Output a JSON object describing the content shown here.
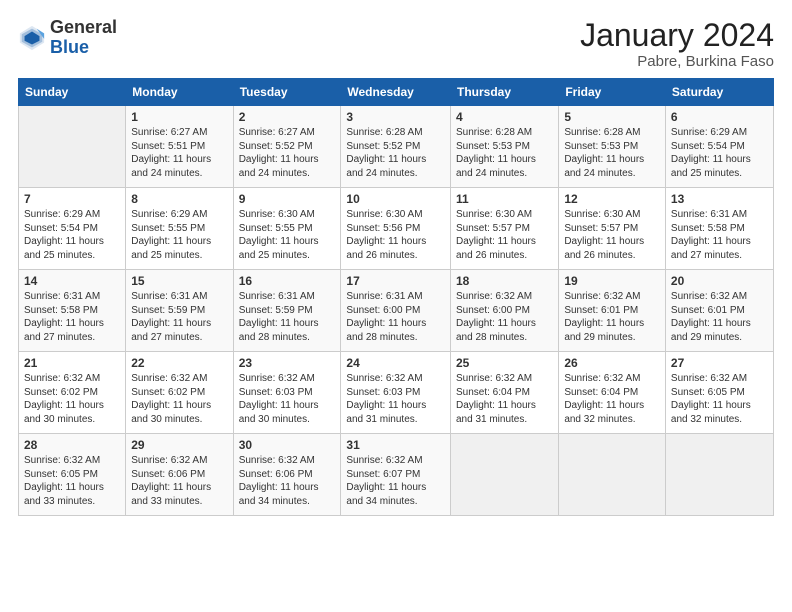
{
  "header": {
    "logo_general": "General",
    "logo_blue": "Blue",
    "title": "January 2024",
    "subtitle": "Pabre, Burkina Faso"
  },
  "days_of_week": [
    "Sunday",
    "Monday",
    "Tuesday",
    "Wednesday",
    "Thursday",
    "Friday",
    "Saturday"
  ],
  "weeks": [
    [
      {
        "day": "",
        "sunrise": "",
        "sunset": "",
        "daylight": ""
      },
      {
        "day": "1",
        "sunrise": "Sunrise: 6:27 AM",
        "sunset": "Sunset: 5:51 PM",
        "daylight": "Daylight: 11 hours and 24 minutes."
      },
      {
        "day": "2",
        "sunrise": "Sunrise: 6:27 AM",
        "sunset": "Sunset: 5:52 PM",
        "daylight": "Daylight: 11 hours and 24 minutes."
      },
      {
        "day": "3",
        "sunrise": "Sunrise: 6:28 AM",
        "sunset": "Sunset: 5:52 PM",
        "daylight": "Daylight: 11 hours and 24 minutes."
      },
      {
        "day": "4",
        "sunrise": "Sunrise: 6:28 AM",
        "sunset": "Sunset: 5:53 PM",
        "daylight": "Daylight: 11 hours and 24 minutes."
      },
      {
        "day": "5",
        "sunrise": "Sunrise: 6:28 AM",
        "sunset": "Sunset: 5:53 PM",
        "daylight": "Daylight: 11 hours and 24 minutes."
      },
      {
        "day": "6",
        "sunrise": "Sunrise: 6:29 AM",
        "sunset": "Sunset: 5:54 PM",
        "daylight": "Daylight: 11 hours and 25 minutes."
      }
    ],
    [
      {
        "day": "7",
        "sunrise": "Sunrise: 6:29 AM",
        "sunset": "Sunset: 5:54 PM",
        "daylight": "Daylight: 11 hours and 25 minutes."
      },
      {
        "day": "8",
        "sunrise": "Sunrise: 6:29 AM",
        "sunset": "Sunset: 5:55 PM",
        "daylight": "Daylight: 11 hours and 25 minutes."
      },
      {
        "day": "9",
        "sunrise": "Sunrise: 6:30 AM",
        "sunset": "Sunset: 5:55 PM",
        "daylight": "Daylight: 11 hours and 25 minutes."
      },
      {
        "day": "10",
        "sunrise": "Sunrise: 6:30 AM",
        "sunset": "Sunset: 5:56 PM",
        "daylight": "Daylight: 11 hours and 26 minutes."
      },
      {
        "day": "11",
        "sunrise": "Sunrise: 6:30 AM",
        "sunset": "Sunset: 5:57 PM",
        "daylight": "Daylight: 11 hours and 26 minutes."
      },
      {
        "day": "12",
        "sunrise": "Sunrise: 6:30 AM",
        "sunset": "Sunset: 5:57 PM",
        "daylight": "Daylight: 11 hours and 26 minutes."
      },
      {
        "day": "13",
        "sunrise": "Sunrise: 6:31 AM",
        "sunset": "Sunset: 5:58 PM",
        "daylight": "Daylight: 11 hours and 27 minutes."
      }
    ],
    [
      {
        "day": "14",
        "sunrise": "Sunrise: 6:31 AM",
        "sunset": "Sunset: 5:58 PM",
        "daylight": "Daylight: 11 hours and 27 minutes."
      },
      {
        "day": "15",
        "sunrise": "Sunrise: 6:31 AM",
        "sunset": "Sunset: 5:59 PM",
        "daylight": "Daylight: 11 hours and 27 minutes."
      },
      {
        "day": "16",
        "sunrise": "Sunrise: 6:31 AM",
        "sunset": "Sunset: 5:59 PM",
        "daylight": "Daylight: 11 hours and 28 minutes."
      },
      {
        "day": "17",
        "sunrise": "Sunrise: 6:31 AM",
        "sunset": "Sunset: 6:00 PM",
        "daylight": "Daylight: 11 hours and 28 minutes."
      },
      {
        "day": "18",
        "sunrise": "Sunrise: 6:32 AM",
        "sunset": "Sunset: 6:00 PM",
        "daylight": "Daylight: 11 hours and 28 minutes."
      },
      {
        "day": "19",
        "sunrise": "Sunrise: 6:32 AM",
        "sunset": "Sunset: 6:01 PM",
        "daylight": "Daylight: 11 hours and 29 minutes."
      },
      {
        "day": "20",
        "sunrise": "Sunrise: 6:32 AM",
        "sunset": "Sunset: 6:01 PM",
        "daylight": "Daylight: 11 hours and 29 minutes."
      }
    ],
    [
      {
        "day": "21",
        "sunrise": "Sunrise: 6:32 AM",
        "sunset": "Sunset: 6:02 PM",
        "daylight": "Daylight: 11 hours and 30 minutes."
      },
      {
        "day": "22",
        "sunrise": "Sunrise: 6:32 AM",
        "sunset": "Sunset: 6:02 PM",
        "daylight": "Daylight: 11 hours and 30 minutes."
      },
      {
        "day": "23",
        "sunrise": "Sunrise: 6:32 AM",
        "sunset": "Sunset: 6:03 PM",
        "daylight": "Daylight: 11 hours and 30 minutes."
      },
      {
        "day": "24",
        "sunrise": "Sunrise: 6:32 AM",
        "sunset": "Sunset: 6:03 PM",
        "daylight": "Daylight: 11 hours and 31 minutes."
      },
      {
        "day": "25",
        "sunrise": "Sunrise: 6:32 AM",
        "sunset": "Sunset: 6:04 PM",
        "daylight": "Daylight: 11 hours and 31 minutes."
      },
      {
        "day": "26",
        "sunrise": "Sunrise: 6:32 AM",
        "sunset": "Sunset: 6:04 PM",
        "daylight": "Daylight: 11 hours and 32 minutes."
      },
      {
        "day": "27",
        "sunrise": "Sunrise: 6:32 AM",
        "sunset": "Sunset: 6:05 PM",
        "daylight": "Daylight: 11 hours and 32 minutes."
      }
    ],
    [
      {
        "day": "28",
        "sunrise": "Sunrise: 6:32 AM",
        "sunset": "Sunset: 6:05 PM",
        "daylight": "Daylight: 11 hours and 33 minutes."
      },
      {
        "day": "29",
        "sunrise": "Sunrise: 6:32 AM",
        "sunset": "Sunset: 6:06 PM",
        "daylight": "Daylight: 11 hours and 33 minutes."
      },
      {
        "day": "30",
        "sunrise": "Sunrise: 6:32 AM",
        "sunset": "Sunset: 6:06 PM",
        "daylight": "Daylight: 11 hours and 34 minutes."
      },
      {
        "day": "31",
        "sunrise": "Sunrise: 6:32 AM",
        "sunset": "Sunset: 6:07 PM",
        "daylight": "Daylight: 11 hours and 34 minutes."
      },
      {
        "day": "",
        "sunrise": "",
        "sunset": "",
        "daylight": ""
      },
      {
        "day": "",
        "sunrise": "",
        "sunset": "",
        "daylight": ""
      },
      {
        "day": "",
        "sunrise": "",
        "sunset": "",
        "daylight": ""
      }
    ]
  ]
}
